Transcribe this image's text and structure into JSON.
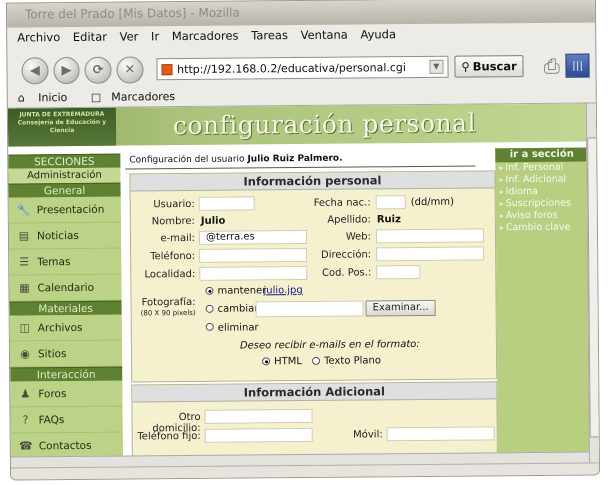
{
  "window": {
    "title": "Torre del Prado [Mis Datos] - Mozilla"
  },
  "menu": [
    "Archivo",
    "Editar",
    "Ver",
    "Ir",
    "Marcadores",
    "Tareas",
    "Ventana",
    "Ayuda"
  ],
  "nav": {
    "url": "http://192.168.0.2/educativa/personal.cgi",
    "search_label": "Buscar"
  },
  "bookmarks": {
    "home_label": "Inicio",
    "bookmarks_label": "Marcadores"
  },
  "banner": {
    "title": "configuración personal",
    "logo_text": "JUNTA DE EXTREMADURA Consejería de Educación y Ciencia"
  },
  "sidebar": {
    "secciones_header": "SECCIONES",
    "admin_label": "Administración",
    "general_header": "General",
    "general_items": [
      {
        "label": "Presentación",
        "icon": "wrench-icon"
      },
      {
        "label": "Noticias",
        "icon": "news-icon"
      },
      {
        "label": "Temas",
        "icon": "list-icon"
      },
      {
        "label": "Calendario",
        "icon": "calendar-icon"
      }
    ],
    "materiales_header": "Materiales",
    "materiales_items": [
      {
        "label": "Archivos",
        "icon": "file-icon"
      },
      {
        "label": "Sitios",
        "icon": "globe-icon"
      }
    ],
    "interaccion_header": "Interacción",
    "interaccion_items": [
      {
        "label": "Foros",
        "icon": "people-icon"
      },
      {
        "label": "FAQs",
        "icon": "question-icon"
      },
      {
        "label": "Contactos",
        "icon": "contacts-icon"
      }
    ]
  },
  "main": {
    "config_prefix": "Configuración del usuario",
    "config_user": "Julio Ruiz Palmero.",
    "personal_header": "Información personal",
    "usuario_label": "Usuario:",
    "fecha_label": "Fecha nac.:",
    "fecha_format": "(dd/mm)",
    "nombre_label": "Nombre:",
    "nombre_value": "Julio",
    "apellido_label": "Apellido:",
    "apellido_value": "Ruiz",
    "email_label": "e-mail:",
    "email_value": "@terra.es",
    "web_label": "Web:",
    "telefono_label": "Teléfono:",
    "direccion_label": "Dirección:",
    "localidad_label": "Localidad:",
    "codpos_label": "Cod. Pos.:",
    "foto_label": "Fotografía:",
    "foto_size": "(80 X 90 pixels)",
    "mantener_label": "mantener",
    "mantener_file": "julio.jpg",
    "cambiar_label": "cambiar:",
    "examinar_label": "Examinar...",
    "eliminar_label": "eliminar",
    "formato_question": "Deseo recibir e-mails en el formato:",
    "html_label": "HTML",
    "texto_label": "Texto Plano",
    "adicional_header": "Información Adicional",
    "otro_domicilio_label": "Otro domicilio:",
    "telefono_fijo_label": "Teléfono fijo:",
    "movil_label": "Móvil:"
  },
  "right": {
    "header": "ir a sección",
    "links": [
      "Inf. Personal",
      "Inf. Adicional",
      "Idioma",
      "Suscripciones",
      "Aviso foros",
      "Cambio clave"
    ]
  }
}
